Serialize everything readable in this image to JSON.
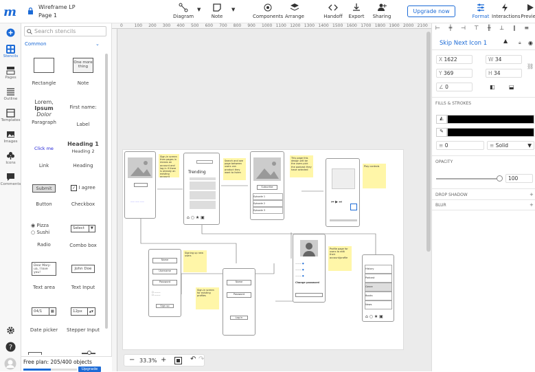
{
  "app": {
    "title": "Wireframe LP",
    "page": "Page 1",
    "upgrade_label": "Upgrade now"
  },
  "toolbar": [
    {
      "label": "Diagram",
      "icon": "diagram-icon"
    },
    {
      "label": "Note",
      "icon": "note-icon"
    },
    {
      "label": "Components",
      "icon": "components-icon"
    },
    {
      "label": "Arrange",
      "icon": "arrange-icon"
    },
    {
      "label": "Handoff",
      "icon": "handoff-icon"
    },
    {
      "label": "Export",
      "icon": "export-icon"
    },
    {
      "label": "Sharing",
      "icon": "sharing-icon"
    }
  ],
  "right_tabs": [
    {
      "label": "Format"
    },
    {
      "label": "Interactions"
    },
    {
      "label": "Preview"
    }
  ],
  "rail": [
    {
      "label": "Stencils"
    },
    {
      "label": "Pages"
    },
    {
      "label": "Outline"
    },
    {
      "label": "Templates"
    },
    {
      "label": "Images"
    },
    {
      "label": "Icons"
    },
    {
      "label": "Comments"
    }
  ],
  "stencils": {
    "search_placeholder": "Search stencils",
    "category": "Common",
    "items": [
      {
        "label": "Rectangle"
      },
      {
        "label": "Note"
      },
      {
        "label": "Paragraph"
      },
      {
        "label": "Label"
      },
      {
        "label": "Link"
      },
      {
        "label": "Heading"
      },
      {
        "label": "Button"
      },
      {
        "label": "Checkbox"
      },
      {
        "label": "Radio"
      },
      {
        "label": "Combo box"
      },
      {
        "label": "Text area"
      },
      {
        "label": "Text Input"
      },
      {
        "label": "Date picker"
      },
      {
        "label": "Stepper Input"
      }
    ],
    "previews": {
      "note_text": "One more thing",
      "lorem1": "Lorem,",
      "lorem2": "Ipsum",
      "lorem3": "Dolor",
      "first_name": "First name:",
      "click_me": "Click me",
      "heading1": "Heading 1",
      "heading2": "Heading 2",
      "submit": "Submit",
      "agree": "I agree",
      "pizza": "Pizza",
      "sushi": "Sushi",
      "select": "Select",
      "textarea": "Dear Mary-ua, I love you!",
      "john_doe": "John Doe",
      "date": "04/1",
      "stepper": "12px"
    }
  },
  "plan": {
    "text": "Free plan: 205/400 objects",
    "upgrade": "Upgrade",
    "progress": 0.51
  },
  "zoom": {
    "value": "33.3%"
  },
  "ruler": [
    "0",
    "100",
    "200",
    "300",
    "400",
    "500",
    "600",
    "700",
    "800",
    "900",
    "1000",
    "1100",
    "1200",
    "1300",
    "1400",
    "1500",
    "1600",
    "1700",
    "1800",
    "1900",
    "2000",
    "2100"
  ],
  "format": {
    "name": "Skip Next Icon 1",
    "x": "1622",
    "y": "369",
    "w": "34",
    "h": "34",
    "angle": "0",
    "fills_title": "FILLS & STROKES",
    "fill_color": "#000000",
    "stroke_color": "#000000",
    "stroke_width": "0",
    "stroke_style": "Solid",
    "opacity_title": "OPACITY",
    "opacity": "100",
    "drop_shadow": "DROP SHADOW",
    "blur": "BLUR"
  },
  "canvas": {
    "trending": "Trending",
    "subscribe": "Subscribe",
    "notes": [
      "Sign-in screen then pages in means an account and log in if there is already an existing account",
      "Search and see page between users can product they want to listen",
      "This page this design will be the users pick the podcast they have selected",
      "Play controls",
      "Signing up new users",
      "Sign-in screen for existing profiles",
      "Profile page for users to edit their account/profile"
    ],
    "episodes": [
      "Episode 1",
      "Episode 2",
      "Episode 3"
    ],
    "inputs": [
      "Name",
      "Username",
      "Password"
    ],
    "signup": "Sign up",
    "login": "Log in",
    "change_password": "Change password",
    "list_items": [
      "History",
      "Podcast",
      "Genre",
      "Books",
      "News"
    ]
  }
}
